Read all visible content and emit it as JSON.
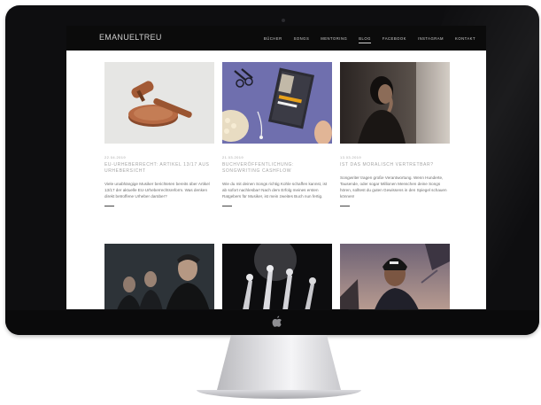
{
  "site": {
    "logo": "EMANUELTREU",
    "nav": [
      "BÜCHER",
      "SONGS",
      "MENTORING",
      "BLOG",
      "FACEBOOK",
      "INSTAGRAM",
      "KONTAKT"
    ],
    "active_nav": "BLOG"
  },
  "posts": [
    {
      "date": "22.04.2019",
      "title": "EU-URHEBERRECHT: ARTIKEL 13/17 AUS URHEBERSICHT",
      "excerpt": "Viele unabhängige Musiker berichteten bereits über Artikel 13/17 der aktuelle EU-Urheberrechtsreform. Was denken direkt betroffene Urheber darüber?"
    },
    {
      "date": "21.03.2019",
      "title": "BUCHVERÖFFENTLICHUNG: SONGWRITING CASHFLOW",
      "excerpt": "Wie du mit deinen Songs richtig Kohle schaffen kannst, ist ab sofort nachlesbar! Nach dem Erfolg meines ersten Ratgebers für Musiker, ist mein zweites Buch nun fertig."
    },
    {
      "date": "13.03.2019",
      "title": "IST DAS MORALISCH VERTRETBAR?",
      "excerpt": "Songwriter tragen große Verantwortung. Wenn Hunderte, Tausende, oder sogar Millionen Menschen deine Songs hören, solltest du guten Gewissens in den Spiegel schauen können!"
    },
    {
      "date": "",
      "title": "",
      "excerpt": ""
    },
    {
      "date": "",
      "title": "",
      "excerpt": ""
    },
    {
      "date": "",
      "title": "",
      "excerpt": ""
    }
  ],
  "colors": {
    "header_bg": "#0b0b0b",
    "title_gray": "#a4a4a4",
    "bezel": "#0e0e10",
    "book_bg": "#6f6fae"
  }
}
